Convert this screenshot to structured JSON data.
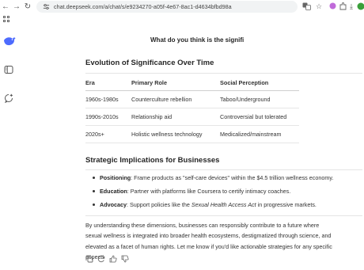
{
  "browser": {
    "url": "chat.deepseek.com/a/chat/s/e9234270-a05f-4e67-8ac1-d4634bfbd98a",
    "back_icon": "arrow-left-icon",
    "forward_icon": "arrow-right-icon",
    "reload_icon": "reload-icon",
    "profile_initial": "O"
  },
  "chat": {
    "title": "What do you think is the signifi"
  },
  "evolution": {
    "heading": "Evolution of Significance Over Time",
    "headers": [
      "Era",
      "Primary Role",
      "Social Perception"
    ],
    "rows": [
      [
        "1960s-1980s",
        "Counterculture rebellion",
        "Taboo/Underground"
      ],
      [
        "1990s-2010s",
        "Relationship aid",
        "Controversial but tolerated"
      ],
      [
        "2020s+",
        "Holistic wellness technology",
        "Medicalized/mainstream"
      ]
    ]
  },
  "strategic": {
    "heading": "Strategic Implications for Businesses",
    "items": [
      {
        "label": "Positioning",
        "text": ": Frame products as \"self-care devices\" within the $4.5 trillion wellness economy."
      },
      {
        "label": "Education",
        "text": ": Partner with platforms like Coursera to certify intimacy coaches."
      },
      {
        "label": "Advocacy",
        "text": ": Support policies like the ",
        "italic": "Sexual Health Access Act",
        "tail": " in progressive markets."
      }
    ]
  },
  "closing": {
    "lines": [
      "By understanding these dimensions, businesses can responsibly contribute to a future where",
      "sexual wellness is integrated into broader health ecosystems, destigmatized through science, and",
      "elevated as a facet of human rights. Let me know if you'd like actionable strategies for any specific",
      "aspect!"
    ]
  },
  "actions": [
    "copy-icon",
    "regenerate-icon",
    "thumbs-up-icon",
    "thumbs-down-icon"
  ],
  "colors": {
    "brand": "#4d6bfe",
    "text": "#262626",
    "urlbar_bg": "#f1f3f4"
  }
}
